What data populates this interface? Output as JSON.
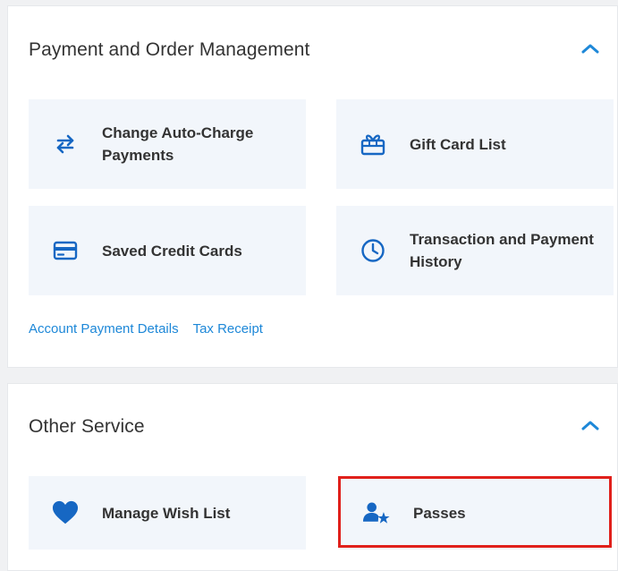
{
  "payment_section": {
    "title": "Payment and Order Management",
    "cards": [
      {
        "label": "Change Auto-Charge Payments",
        "icon": "swap-arrows-icon"
      },
      {
        "label": "Gift Card List",
        "icon": "gift-card-icon"
      },
      {
        "label": "Saved Credit Cards",
        "icon": "credit-card-icon"
      },
      {
        "label": "Transaction and Payment History",
        "icon": "clock-icon"
      }
    ],
    "links": [
      "Account Payment Details",
      "Tax Receipt"
    ]
  },
  "other_section": {
    "title": "Other Service",
    "cards": [
      {
        "label": "Manage Wish List",
        "icon": "heart-icon"
      },
      {
        "label": "Passes",
        "icon": "user-star-icon"
      }
    ]
  },
  "colors": {
    "accent": "#1e88d8",
    "icon_blue": "#1667c3",
    "card_bg": "#f2f6fb",
    "highlight_red": "#e0201b",
    "text": "#333333"
  }
}
